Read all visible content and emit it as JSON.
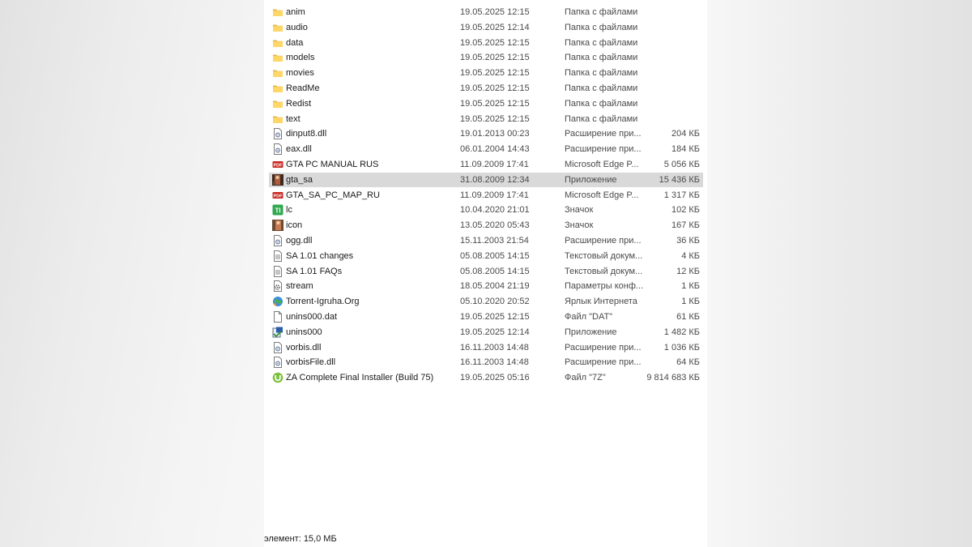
{
  "files": [
    {
      "name": "anim",
      "date": "19.05.2025 12:15",
      "type": "Папка с файлами",
      "size": "",
      "icon": "folder-icon"
    },
    {
      "name": "audio",
      "date": "19.05.2025 12:14",
      "type": "Папка с файлами",
      "size": "",
      "icon": "folder-icon"
    },
    {
      "name": "data",
      "date": "19.05.2025 12:15",
      "type": "Папка с файлами",
      "size": "",
      "icon": "folder-icon"
    },
    {
      "name": "models",
      "date": "19.05.2025 12:15",
      "type": "Папка с файлами",
      "size": "",
      "icon": "folder-icon"
    },
    {
      "name": "movies",
      "date": "19.05.2025 12:15",
      "type": "Папка с файлами",
      "size": "",
      "icon": "folder-icon"
    },
    {
      "name": "ReadMe",
      "date": "19.05.2025 12:15",
      "type": "Папка с файлами",
      "size": "",
      "icon": "folder-icon"
    },
    {
      "name": "Redist",
      "date": "19.05.2025 12:15",
      "type": "Папка с файлами",
      "size": "",
      "icon": "folder-icon"
    },
    {
      "name": "text",
      "date": "19.05.2025 12:15",
      "type": "Папка с файлами",
      "size": "",
      "icon": "folder-icon"
    },
    {
      "name": "dinput8.dll",
      "date": "19.01.2013 00:23",
      "type": "Расширение при...",
      "size": "204 КБ",
      "icon": "dll-file-icon"
    },
    {
      "name": "eax.dll",
      "date": "06.01.2004 14:43",
      "type": "Расширение при...",
      "size": "184 КБ",
      "icon": "dll-file-icon"
    },
    {
      "name": "GTA  PC MANUAL RUS",
      "date": "11.09.2009 17:41",
      "type": "Microsoft Edge P...",
      "size": "5 056 КБ",
      "icon": "pdf-icon"
    },
    {
      "name": "gta_sa",
      "date": "31.08.2009 12:34",
      "type": "Приложение",
      "size": "15 436 КБ",
      "icon": "game-app-icon",
      "selected": true
    },
    {
      "name": "GTA_SA_PC_MAP_RU",
      "date": "11.09.2009 17:41",
      "type": "Microsoft Edge P...",
      "size": "1 317 КБ",
      "icon": "pdf-icon"
    },
    {
      "name": "lc",
      "date": "10.04.2020 21:01",
      "type": "Значок",
      "size": "102 КБ",
      "icon": "green-ico-icon"
    },
    {
      "name": "icon",
      "date": "13.05.2020 05:43",
      "type": "Значок",
      "size": "167 КБ",
      "icon": "game-ico-icon"
    },
    {
      "name": "ogg.dll",
      "date": "15.11.2003 21:54",
      "type": "Расширение при...",
      "size": "36 КБ",
      "icon": "dll-file-icon"
    },
    {
      "name": "SA 1.01 changes",
      "date": "05.08.2005 14:15",
      "type": "Текстовый докум...",
      "size": "4 КБ",
      "icon": "text-file-icon"
    },
    {
      "name": "SA 1.01 FAQs",
      "date": "05.08.2005 14:15",
      "type": "Текстовый докум...",
      "size": "12 КБ",
      "icon": "text-file-icon"
    },
    {
      "name": "stream",
      "date": "18.05.2004 21:19",
      "type": "Параметры конф...",
      "size": "1 КБ",
      "icon": "config-file-icon"
    },
    {
      "name": "Torrent-Igruha.Org",
      "date": "05.10.2020 20:52",
      "type": "Ярлык Интернета",
      "size": "1 КБ",
      "icon": "internet-shortcut-icon"
    },
    {
      "name": "unins000.dat",
      "date": "19.05.2025 12:15",
      "type": "Файл \"DAT\"",
      "size": "61 КБ",
      "icon": "blank-file-icon"
    },
    {
      "name": "unins000",
      "date": "19.05.2025 12:14",
      "type": "Приложение",
      "size": "1 482 КБ",
      "icon": "installer-app-icon"
    },
    {
      "name": "vorbis.dll",
      "date": "16.11.2003 14:48",
      "type": "Расширение при...",
      "size": "1 036 КБ",
      "icon": "dll-file-icon"
    },
    {
      "name": "vorbisFile.dll",
      "date": "16.11.2003 14:48",
      "type": "Расширение при...",
      "size": "64 КБ",
      "icon": "dll-file-icon"
    },
    {
      "name": "ZA Complete Final Installer (Build 75)",
      "date": "19.05.2025 05:16",
      "type": "Файл \"7Z\"",
      "size": "9 814 683 КБ",
      "icon": "utorrent-icon"
    }
  ],
  "status_bar": {
    "text": "элемент: 15,0 МБ"
  }
}
